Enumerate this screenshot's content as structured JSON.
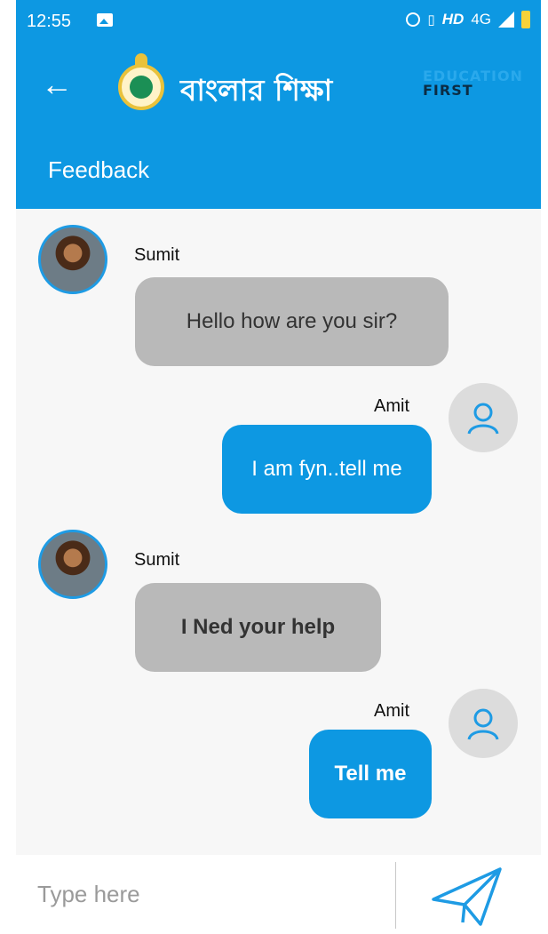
{
  "status_bar": {
    "time": "12:55",
    "network": "HD",
    "network_type": "4G"
  },
  "header": {
    "app_name": "বাংলার শিক্ষা",
    "brand_line1": "EDUCATION",
    "brand_line2": "FIRST",
    "section_title": "Feedback"
  },
  "messages": [
    {
      "sender": "Sumit",
      "text": "Hello how are you sir?",
      "direction": "incoming"
    },
    {
      "sender": "Amit",
      "text": "I am fyn..tell me",
      "direction": "outgoing"
    },
    {
      "sender": "Sumit",
      "text": "I Ned your help",
      "direction": "incoming"
    },
    {
      "sender": "Amit",
      "text": "Tell me",
      "direction": "outgoing"
    }
  ],
  "composer": {
    "placeholder": "Type here",
    "value": ""
  },
  "colors": {
    "primary": "#0d98e2",
    "incoming_bubble": "#b9b9b9",
    "background": "#f7f7f7"
  },
  "icons": {
    "back": "arrow-left-icon",
    "send": "paper-plane-icon",
    "user": "person-icon"
  }
}
